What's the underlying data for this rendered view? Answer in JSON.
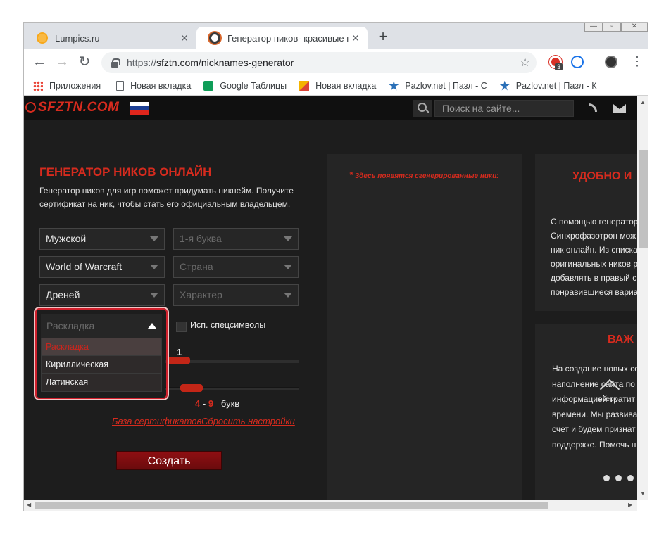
{
  "browser": {
    "tabs": [
      {
        "title": "Lumpics.ru"
      },
      {
        "title": "Генератор ников- красивые ни"
      }
    ],
    "url_prefix": "https://",
    "url": "sfztn.com/nicknames-generator",
    "ext_badge": "3",
    "bookmarks": [
      {
        "label": "Приложения"
      },
      {
        "label": "Новая вкладка"
      },
      {
        "label": "Google Таблицы"
      },
      {
        "label": "Новая вкладка"
      },
      {
        "label": "Pazlov.net | Пазл - С"
      },
      {
        "label": "Pazlov.net | Пазл - К"
      }
    ]
  },
  "site": {
    "logo": "SFZTN.COM",
    "search_placeholder": "Поиск на сайте..."
  },
  "generator": {
    "title": "ГЕНЕРАТОР НИКОВ ОНЛАЙН",
    "description": "Генератор ников для игр поможет придумать никнейм. Получите сертификат на ник, чтобы стать его официальным владельцем.",
    "gender": "Мужской",
    "letter_placeholder": "1-я буква",
    "game": "World of Warcraft",
    "country_placeholder": "Страна",
    "race": "Дреней",
    "character_placeholder": "Характер",
    "layout_placeholder": "Раскладка",
    "layout_options": [
      "Раскладка",
      "Кириллическая",
      "Латинская"
    ],
    "special_chars_label": "Исп. спецсимволы",
    "count_value": "1",
    "length_min": "4",
    "length_sep": "-",
    "length_max": "9",
    "length_unit": "букв",
    "cert_link": "База сертификатов",
    "reset_link": "Сбросить настройки",
    "create_button": "Создать"
  },
  "results": {
    "note": "Здесь появятся сгенерированные ники:"
  },
  "right": {
    "title1": "УДОБНО И",
    "text1": [
      "С помощью генератор",
      "Синхрофазотрон мож",
      "ник онлайн. Из списка",
      "оригинальных ников р",
      "добавлять в правый с",
      "понравившиеся вариа"
    ],
    "title2": "ВАЖ",
    "text2": [
      "На создание новых сс",
      "наполнение сайта по",
      "информацией тратит",
      "времени. Мы развива",
      "счет и будем признат",
      "поддержке. Помочь н"
    ],
    "up_label": "вверх"
  }
}
